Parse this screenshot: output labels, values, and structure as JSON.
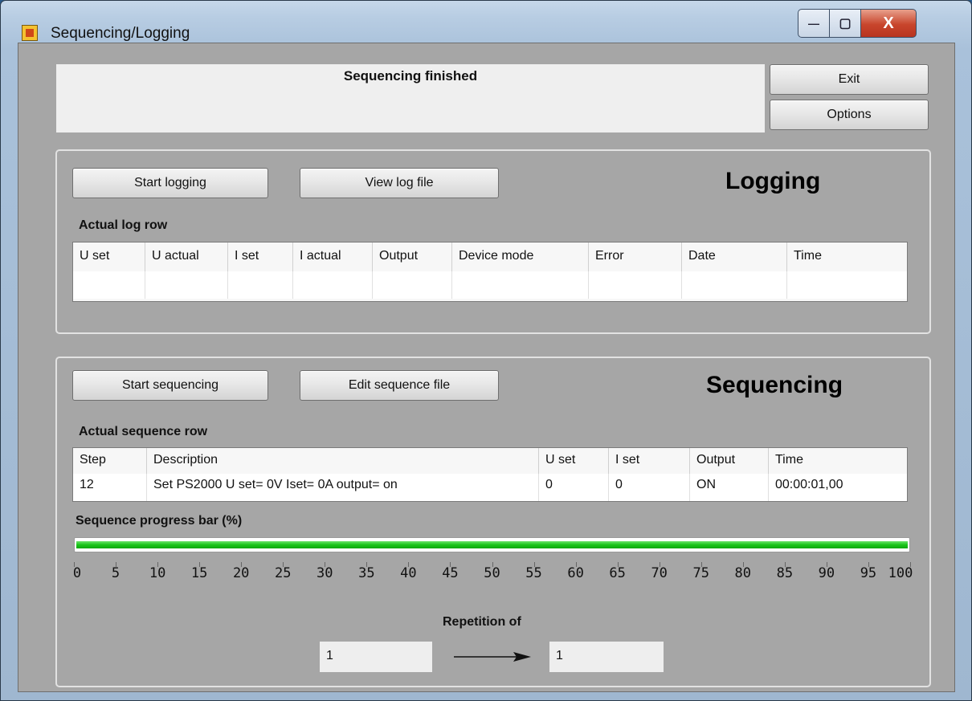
{
  "window": {
    "title": "Sequencing/Logging",
    "minimize_symbol": "—",
    "maximize_symbol": "▢",
    "close_symbol": "X"
  },
  "status": {
    "text": "Sequencing finished"
  },
  "buttons": {
    "exit": "Exit",
    "options": "Options"
  },
  "logging": {
    "title": "Logging",
    "start_button": "Start logging",
    "view_button": "View log file",
    "table_label": "Actual log row",
    "columns": [
      "U set",
      "U actual",
      "I set",
      "I actual",
      "Output",
      "Device mode",
      "Error",
      "Date",
      "Time"
    ],
    "rows": [
      [
        "",
        "",
        "",
        "",
        "",
        "",
        "",
        "",
        ""
      ]
    ]
  },
  "sequencing": {
    "title": "Sequencing",
    "start_button": "Start sequencing",
    "edit_button": "Edit sequence file",
    "table_label": "Actual sequence row",
    "columns": [
      "Step",
      "Description",
      "U set",
      "I set",
      "Output",
      "Time"
    ],
    "rows": [
      [
        "12",
        "Set PS2000 U set= 0V Iset= 0A output= on",
        "0",
        "0",
        "ON",
        "00:00:01,00"
      ]
    ],
    "progress_label": "Sequence progress bar (%)",
    "progress_value": 100,
    "scale_ticks": [
      "0",
      "5",
      "10",
      "15",
      "20",
      "25",
      "30",
      "35",
      "40",
      "45",
      "50",
      "55",
      "60",
      "65",
      "70",
      "75",
      "80",
      "85",
      "90",
      "95",
      "100"
    ],
    "repetition_label": "Repetition of",
    "repetition_current": "1",
    "repetition_total": "1"
  },
  "colors": {
    "progress_fill": "#19c419",
    "panel_background": "#a6a6a6"
  }
}
